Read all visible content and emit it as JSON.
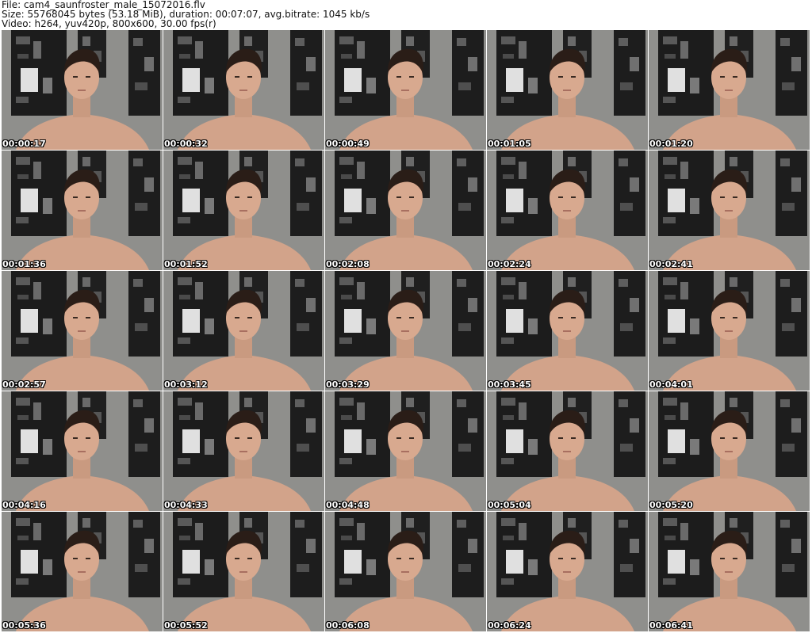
{
  "header": {
    "file_line": "File: cam4_saunfroster_male_15072016.flv",
    "size_line": "Size: 55768045 bytes (53.18 MiB), duration: 00:07:07, avg.bitrate: 1045 kb/s",
    "video_line": "Video: h264, yuv420p, 800x600, 30.00 fps(r)"
  },
  "colors": {
    "background": "#ffffff",
    "wall": "#8a8a88",
    "poster": "#1c1c1c",
    "skin": "#d8a98f",
    "hair": "#2a1d17"
  },
  "thumbnails": [
    {
      "timestamp": "00:00:17",
      "image": "frame-image"
    },
    {
      "timestamp": "00:00:32",
      "image": "frame-image"
    },
    {
      "timestamp": "00:00:49",
      "image": "frame-image"
    },
    {
      "timestamp": "00:01:05",
      "image": "frame-image"
    },
    {
      "timestamp": "00:01:20",
      "image": "frame-image"
    },
    {
      "timestamp": "00:01:36",
      "image": "frame-image"
    },
    {
      "timestamp": "00:01:52",
      "image": "frame-image"
    },
    {
      "timestamp": "00:02:08",
      "image": "frame-image"
    },
    {
      "timestamp": "00:02:24",
      "image": "frame-image"
    },
    {
      "timestamp": "00:02:41",
      "image": "frame-image"
    },
    {
      "timestamp": "00:02:57",
      "image": "frame-image"
    },
    {
      "timestamp": "00:03:12",
      "image": "frame-image"
    },
    {
      "timestamp": "00:03:29",
      "image": "frame-image"
    },
    {
      "timestamp": "00:03:45",
      "image": "frame-image"
    },
    {
      "timestamp": "00:04:01",
      "image": "frame-image"
    },
    {
      "timestamp": "00:04:16",
      "image": "frame-image"
    },
    {
      "timestamp": "00:04:33",
      "image": "frame-image"
    },
    {
      "timestamp": "00:04:48",
      "image": "frame-image"
    },
    {
      "timestamp": "00:05:04",
      "image": "frame-image"
    },
    {
      "timestamp": "00:05:20",
      "image": "frame-image"
    },
    {
      "timestamp": "00:05:36",
      "image": "frame-image"
    },
    {
      "timestamp": "00:05:52",
      "image": "frame-image"
    },
    {
      "timestamp": "00:06:08",
      "image": "frame-image"
    },
    {
      "timestamp": "00:06:24",
      "image": "frame-image"
    },
    {
      "timestamp": "00:06:41",
      "image": "frame-image"
    }
  ]
}
